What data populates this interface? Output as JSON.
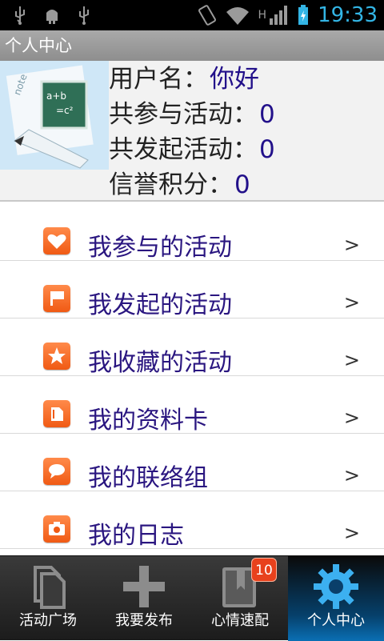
{
  "status_bar": {
    "time": "19:33",
    "network": "H"
  },
  "title_bar": {
    "title": "个人中心"
  },
  "profile": {
    "username_label": "用户名：",
    "username_value": "你好",
    "joined_label": "共参与活动：",
    "joined_value": "0",
    "initiated_label": "共发起活动：",
    "initiated_value": "0",
    "credit_label": "信誉积分：",
    "credit_value": "0",
    "avatar_text": "note"
  },
  "menu": {
    "items": [
      {
        "label": "我参与的活动",
        "icon": "heart-icon",
        "arrow": ">"
      },
      {
        "label": "我发起的活动",
        "icon": "flag-icon",
        "arrow": ">"
      },
      {
        "label": "我收藏的活动",
        "icon": "star-icon",
        "arrow": ">"
      },
      {
        "label": "我的资料卡",
        "icon": "card-icon",
        "arrow": ">"
      },
      {
        "label": "我的联络组",
        "icon": "chat-bubble-icon",
        "arrow": ">"
      },
      {
        "label": "我的日志",
        "icon": "camera-icon",
        "arrow": ">"
      }
    ]
  },
  "tabbar": {
    "tabs": [
      {
        "label": "活动广场",
        "icon": "documents-icon"
      },
      {
        "label": "我要发布",
        "icon": "plus-icon"
      },
      {
        "label": "心情速配",
        "icon": "bookmark-book-icon",
        "badge": "10"
      },
      {
        "label": "个人中心",
        "icon": "gear-icon",
        "active": true
      }
    ]
  },
  "colors": {
    "accent": "#33b5e5",
    "value_text": "#22108a",
    "menu_icon": "#f05a14",
    "active_tab": "#0a6fb4"
  }
}
